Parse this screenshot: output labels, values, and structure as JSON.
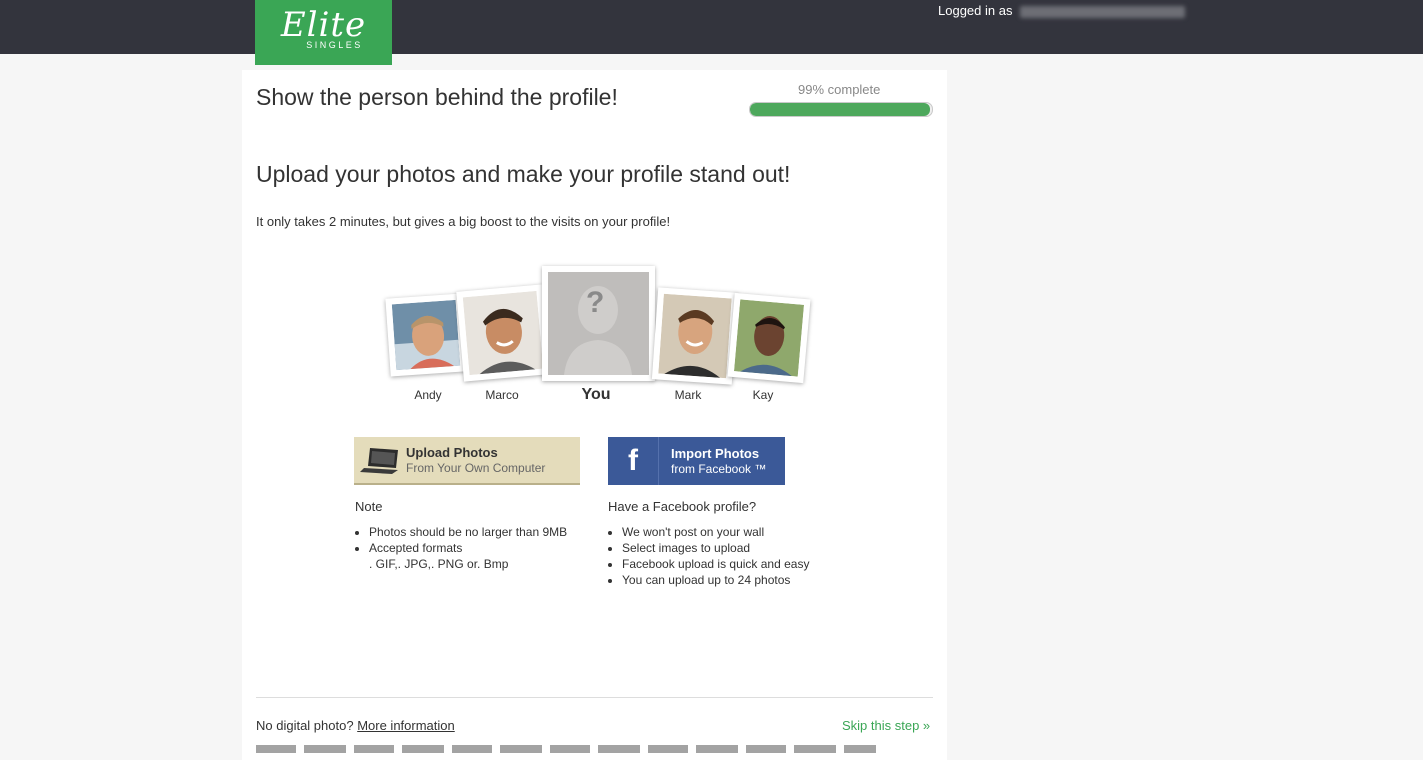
{
  "header": {
    "logo_main": "Elite",
    "logo_sub": "SINGLES",
    "login_prefix": "Logged in as"
  },
  "page": {
    "title": "Show the person behind the profile!",
    "progress_label": "99% complete",
    "progress_value": 0.99,
    "subtitle": "Upload your photos and make your profile stand out!",
    "intro": "It only takes 2 minutes, but gives a big boost to the visits on your profile!"
  },
  "photos": [
    {
      "name": "Andy"
    },
    {
      "name": "Marco"
    },
    {
      "name": "You"
    },
    {
      "name": "Mark"
    },
    {
      "name": "Kay"
    }
  ],
  "placeholder_mark": "?",
  "upload": {
    "title": "Upload Photos",
    "subtitle": "From Your Own Computer",
    "note_heading": "Note",
    "notes": [
      "Photos should be no larger than 9MB",
      "Accepted formats",
      ". GIF,. JPG,. PNG or. Bmp"
    ]
  },
  "facebook": {
    "icon_letter": "f",
    "title": "Import Photos",
    "subtitle": "from Facebook ™",
    "heading": "Have a Facebook profile?",
    "points": [
      "We won't post on your wall",
      "Select images to upload",
      "Facebook upload is quick and easy",
      "You can upload up to 24 photos"
    ]
  },
  "footer": {
    "no_photo": "No digital photo?",
    "more_info": "More information",
    "skip": "Skip this step »"
  },
  "colors": {
    "topbar": "#33343d",
    "brand_green": "#3aa655",
    "facebook_blue": "#3b5998",
    "upload_beige": "#e4dcbb"
  }
}
